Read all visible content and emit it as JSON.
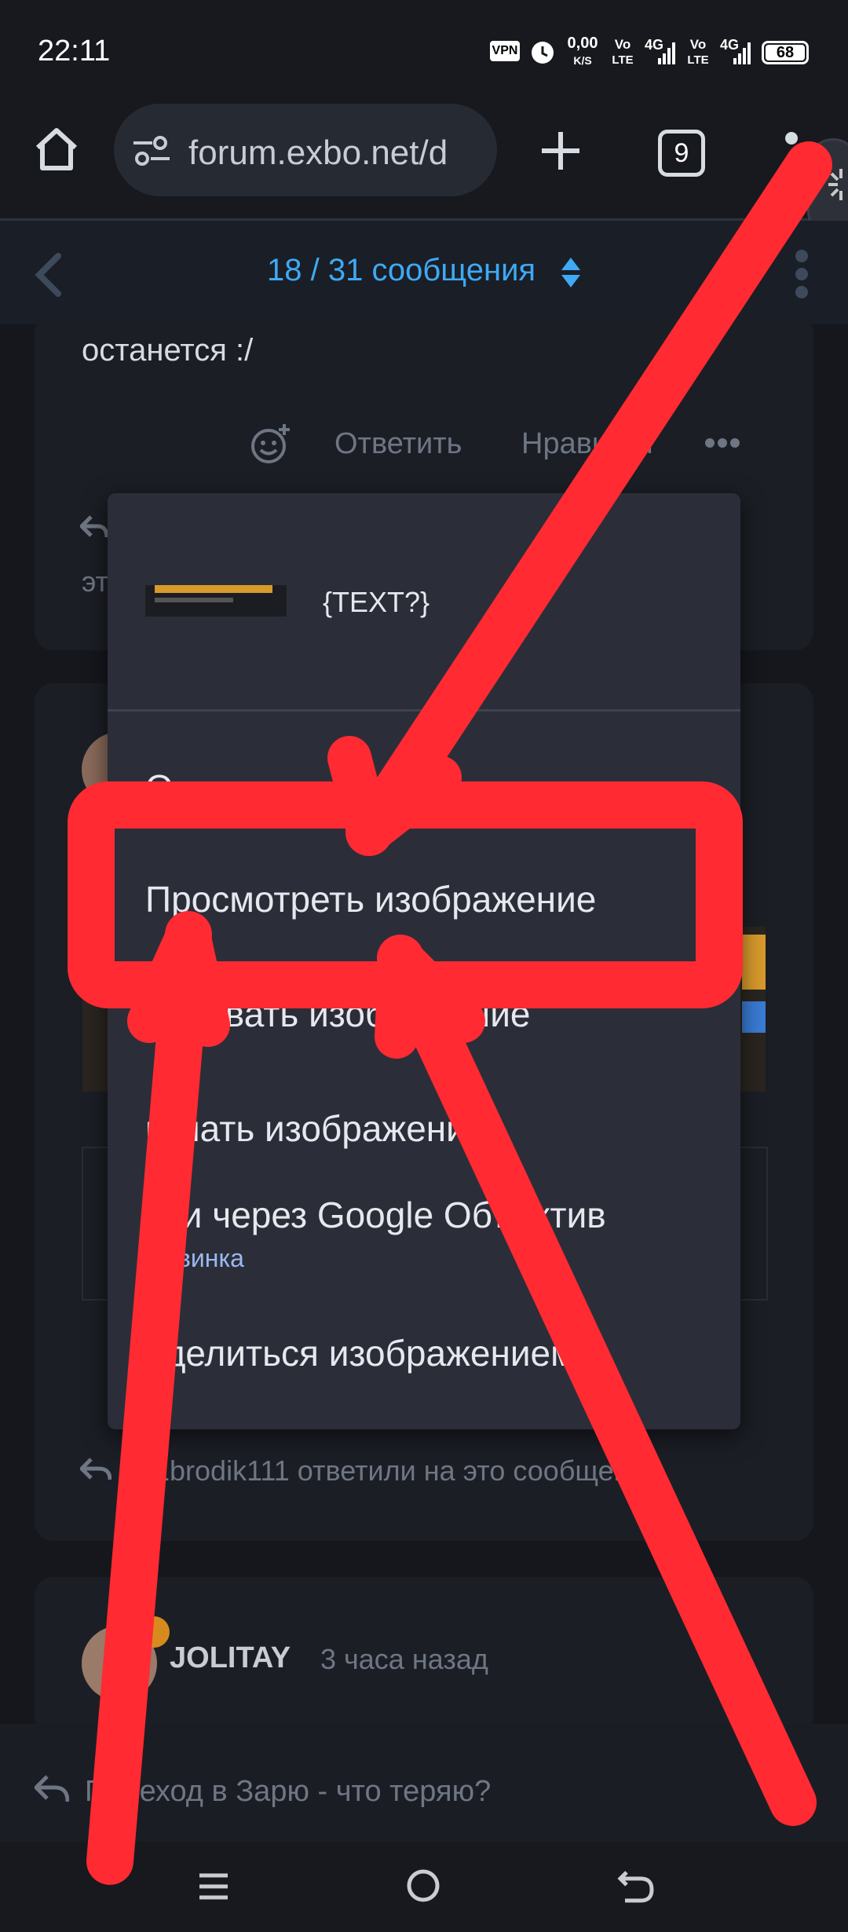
{
  "status_bar": {
    "time": "22:11",
    "vpn": "VPN",
    "speed_value": "0,00",
    "speed_unit": "K/S",
    "sim1_label_top": "Vo",
    "sim1_label_bottom": "LTE",
    "sim1_net": "4G",
    "sim2_label_top": "Vo",
    "sim2_label_bottom": "LTE",
    "sim2_net": "4G",
    "battery": "68"
  },
  "browser": {
    "url": "forum.exbo.net/d",
    "tab_count": "9"
  },
  "forum_header": {
    "counter": "18 / 31 сообщения"
  },
  "post_top": {
    "text_tail": "останется :/",
    "reply_label": "Ответить",
    "like_label": "Нравится",
    "partial_text": "эт"
  },
  "context_menu": {
    "header_text": "{TEXT?}",
    "items": [
      {
        "label": "О",
        "sub": ""
      },
      {
        "label": "Просмотреть изображение",
        "sub": ""
      },
      {
        "label": "пировать изображение",
        "sub": ""
      },
      {
        "label": "качать изображение",
        "sub": ""
      },
      {
        "label": "йти через Google Объектив",
        "sub": "Новинка"
      },
      {
        "label": "оделиться изображением",
        "sub": ""
      }
    ]
  },
  "replies_line": {
    "text": "1brodik111 ответили на это сообщение."
  },
  "next_post": {
    "author": "JOLITAY",
    "time": "3 часа назад"
  },
  "reply_bar": {
    "text": "Переход в Зарю - что теряю?"
  },
  "colors": {
    "accent": "#3fa9f5",
    "annotation_red": "#ff2a32",
    "menu_bg": "#2b2e38",
    "page_bg": "#15171d"
  }
}
